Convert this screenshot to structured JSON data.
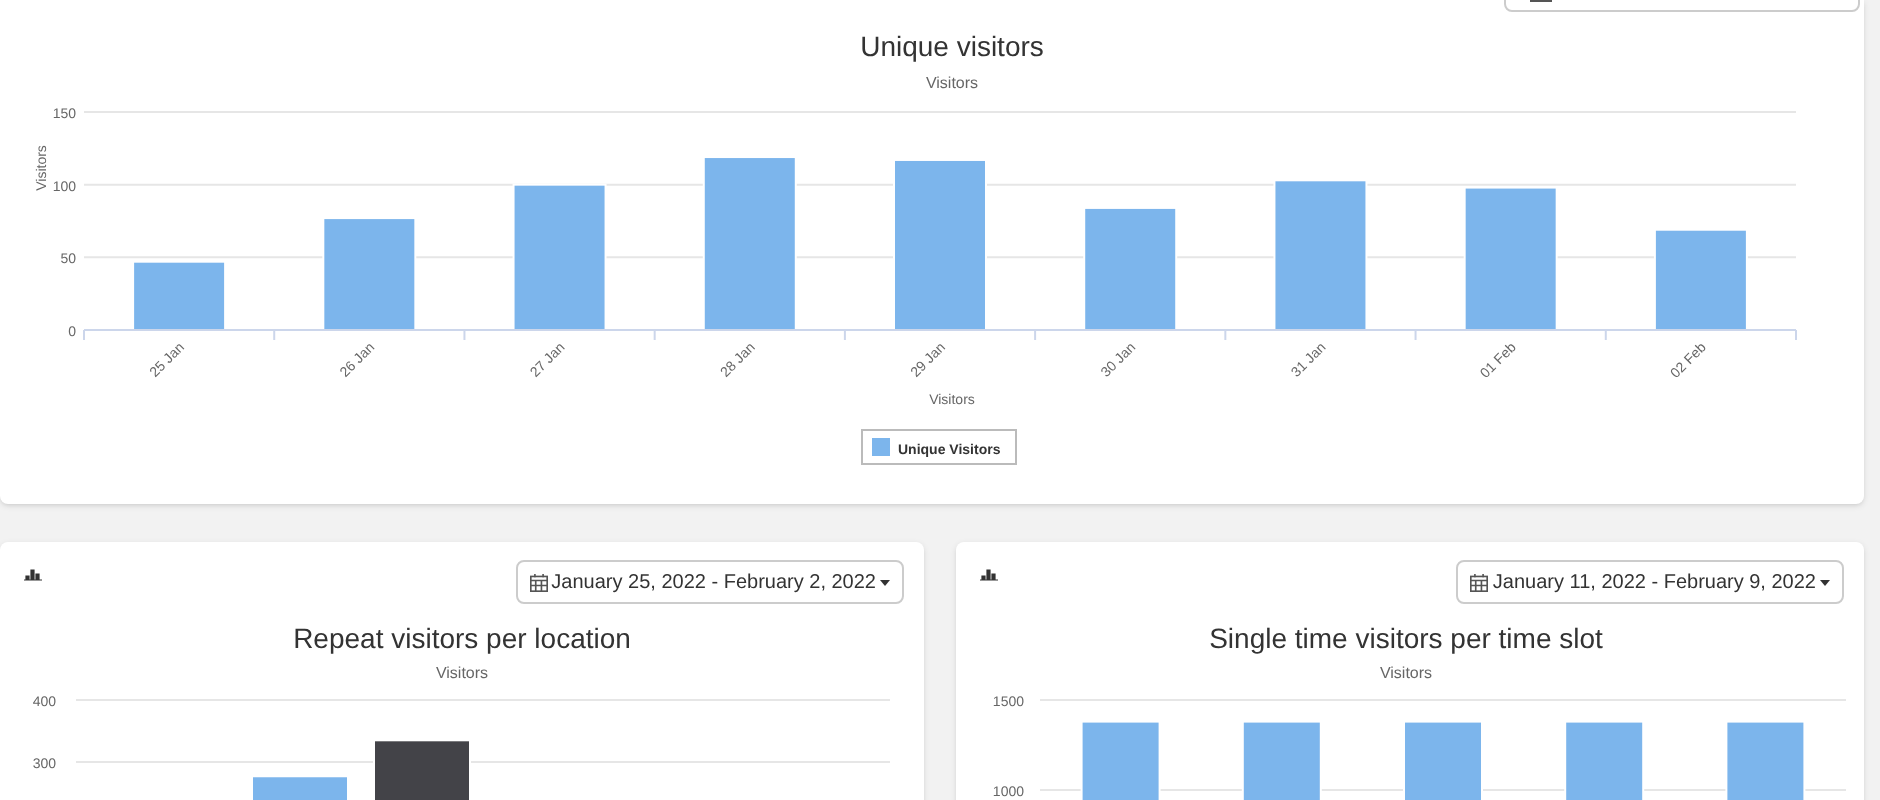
{
  "top_panel": {
    "subtitle": "Visitors",
    "chart_data": {
      "type": "bar",
      "title": "Unique visitors",
      "ylabel": "Visitors",
      "xlabel": "Visitors",
      "categories": [
        "25 Jan",
        "26 Jan",
        "27 Jan",
        "28 Jan",
        "29 Jan",
        "30 Jan",
        "31 Jan",
        "01 Feb",
        "02 Feb"
      ],
      "ylim": [
        0,
        150
      ],
      "yticks": [
        0,
        50,
        100,
        150
      ],
      "series": [
        {
          "name": "Unique Visitors",
          "color": "#7cb5ec",
          "values": [
            47,
            77,
            100,
            119,
            117,
            84,
            103,
            98,
            69
          ]
        }
      ]
    }
  },
  "panels": [
    {
      "date_range": "January 25, 2022 - February 2, 2022",
      "subtitle": "Visitors",
      "chart_data": {
        "type": "bar",
        "title": "Repeat visitors per location",
        "ylim": [
          0,
          400
        ],
        "yticks": [
          300,
          400
        ],
        "stacked": false,
        "series": [
          {
            "color": "#7cb5ec",
            "values": [
              277
            ]
          },
          {
            "color": "#434348",
            "values": [
              335
            ]
          }
        ]
      }
    },
    {
      "date_range": "January 11, 2022 - February 9, 2022",
      "subtitle": "Visitors",
      "chart_data": {
        "type": "bar",
        "title": "Single time visitors per time slot",
        "ylim": [
          0,
          1500
        ],
        "yticks": [
          1000,
          1500
        ],
        "series": [
          {
            "color": "#7cb5ec",
            "values": [
              1380,
              1380,
              1380,
              1380,
              1380
            ]
          }
        ]
      }
    }
  ]
}
